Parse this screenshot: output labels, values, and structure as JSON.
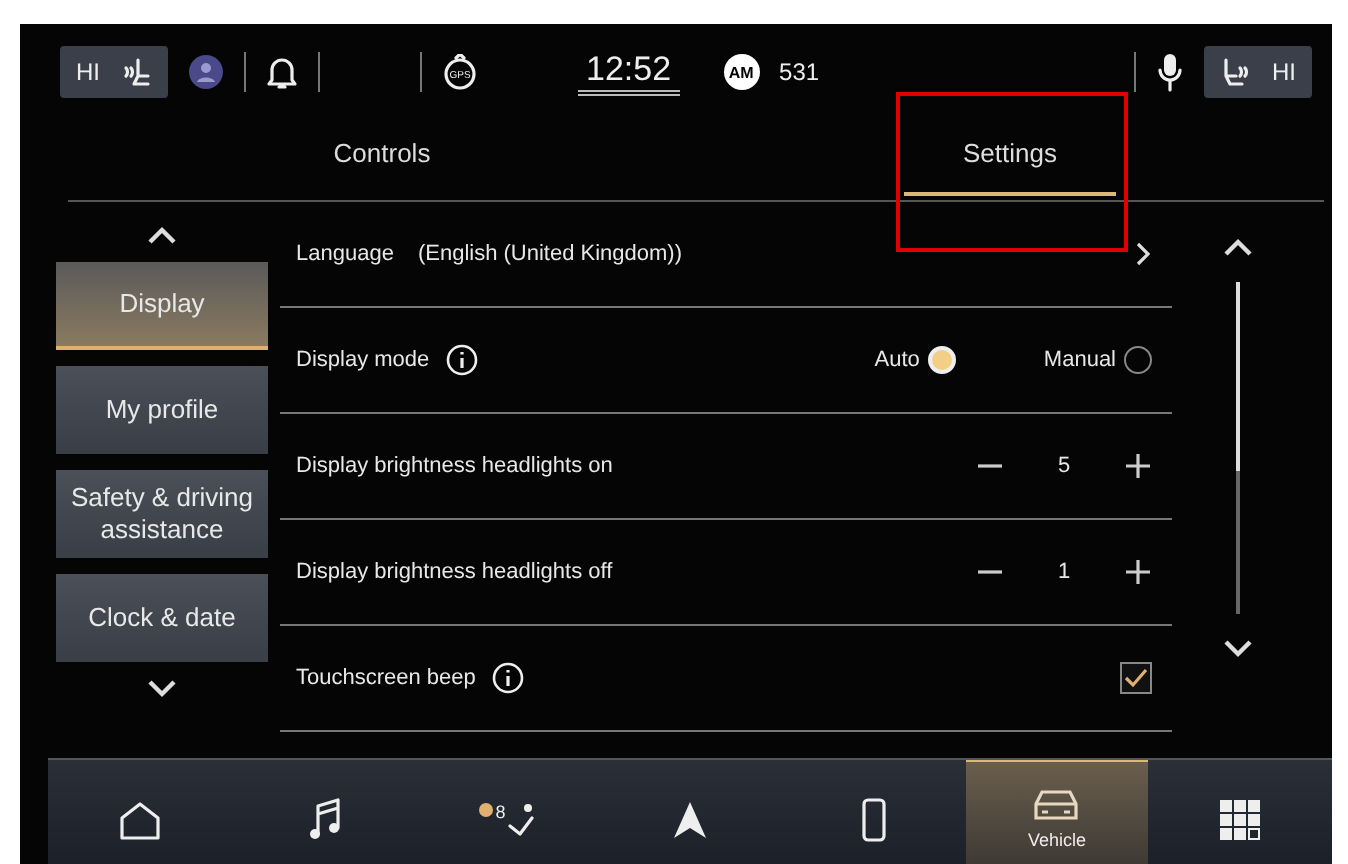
{
  "status_bar": {
    "left_seat": {
      "label": "HI"
    },
    "gps_label": "GPS",
    "clock": "12:52",
    "radio": {
      "band": "AM",
      "station": "531"
    },
    "right_seat": {
      "label": "HI"
    }
  },
  "tabs": [
    {
      "label": "Controls",
      "selected": false
    },
    {
      "label": "Settings",
      "selected": true
    }
  ],
  "annotation": {
    "kind": "box"
  },
  "sidebar": {
    "items": [
      {
        "label": "Display",
        "selected": true
      },
      {
        "label": "My profile",
        "selected": false
      },
      {
        "label": "Safety & driving assistance",
        "selected": false
      },
      {
        "label": "Clock & date",
        "selected": false
      }
    ]
  },
  "settings": [
    {
      "kind": "link",
      "label": "Language",
      "value": "(English (United Kingdom))"
    },
    {
      "kind": "radio",
      "label": "Display mode",
      "info": true,
      "options": [
        {
          "label": "Auto",
          "selected": true
        },
        {
          "label": "Manual",
          "selected": false
        }
      ]
    },
    {
      "kind": "stepper",
      "label": "Display brightness headlights on",
      "value": "5"
    },
    {
      "kind": "stepper",
      "label": "Display brightness headlights off",
      "value": "1"
    },
    {
      "kind": "checkbox",
      "label": "Touchscreen beep",
      "info": true,
      "checked": true
    }
  ],
  "nav_bar": {
    "items": [
      {
        "kind": "home",
        "selected": false
      },
      {
        "kind": "music",
        "selected": false
      },
      {
        "kind": "climate",
        "badge": "8",
        "selected": false
      },
      {
        "kind": "navigation",
        "selected": false
      },
      {
        "kind": "phone",
        "selected": false
      },
      {
        "kind": "vehicle",
        "label": "Vehicle",
        "selected": true
      },
      {
        "kind": "apps",
        "selected": false
      }
    ]
  }
}
